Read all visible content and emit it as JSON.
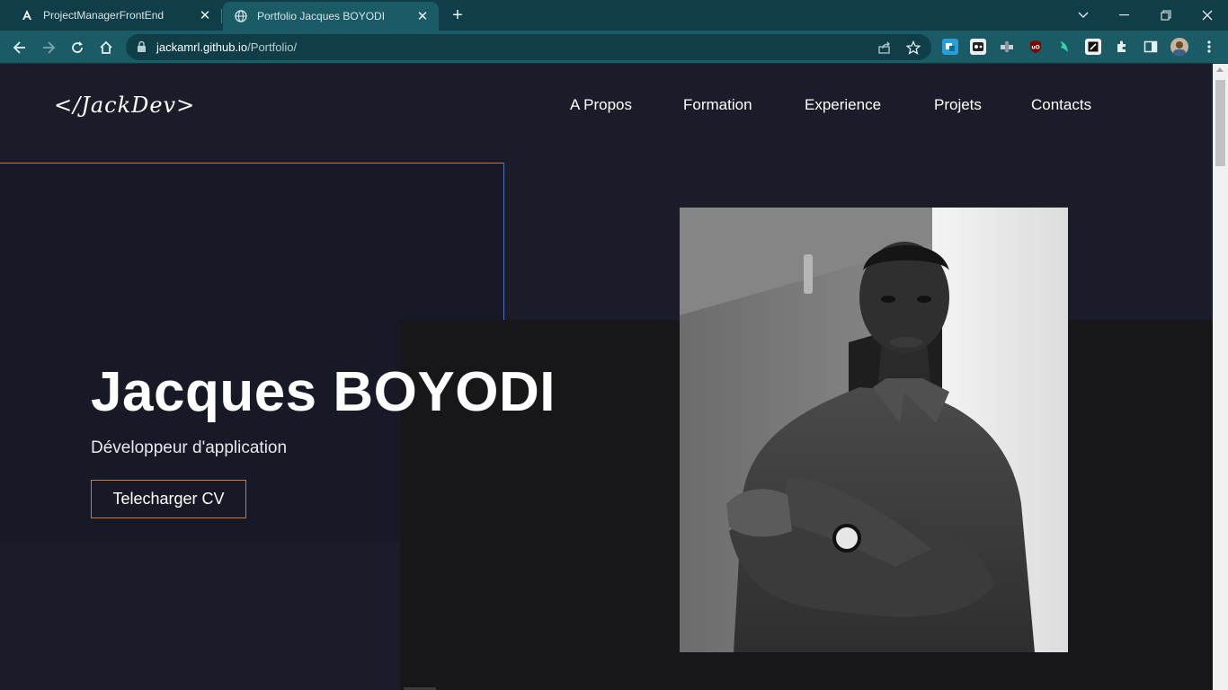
{
  "browser": {
    "tabs": [
      {
        "title": "ProjectManagerFrontEnd",
        "icon": "angular-icon",
        "active": false
      },
      {
        "title": "Portfolio Jacques BOYODI",
        "icon": "globe-icon",
        "active": true
      }
    ],
    "url_host": "jackamrl.github.io",
    "url_path": "/Portfolio/",
    "accent": "#1a5b66"
  },
  "header": {
    "logo": "</JackDev>",
    "nav": [
      "A Propos",
      "Formation",
      "Experience",
      "Projets",
      "Contacts"
    ]
  },
  "hero": {
    "name": "Jacques BOYODI",
    "role": "Développeur d'application",
    "cv_button": "Telecharger CV",
    "accent": "#d07a3d"
  }
}
